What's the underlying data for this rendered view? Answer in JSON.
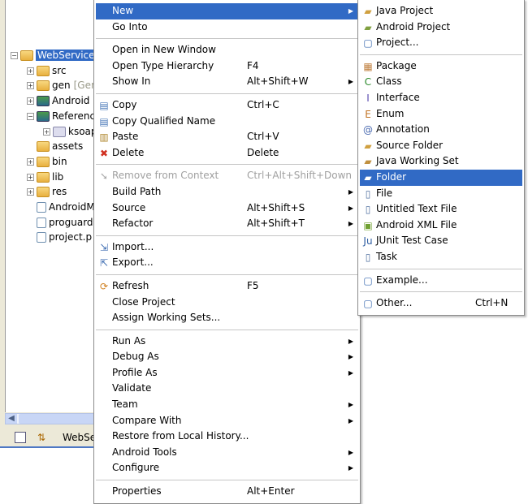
{
  "tree": [
    {
      "label": "WebService",
      "toggle": "−",
      "indent": 0,
      "icon": "project-icon",
      "selected": true
    },
    {
      "label": "src",
      "toggle": "+",
      "indent": 1,
      "icon": "source-folder-icon"
    },
    {
      "label": "gen",
      "decoration": "[Gen",
      "toggle": "+",
      "indent": 1,
      "icon": "source-folder-icon"
    },
    {
      "label": "Android",
      "toggle": "+",
      "indent": 1,
      "icon": "library-icon"
    },
    {
      "label": "Referenc",
      "toggle": "−",
      "indent": 1,
      "icon": "library-icon"
    },
    {
      "label": "ksoap",
      "toggle": "+",
      "indent": 2,
      "icon": "jar-icon"
    },
    {
      "label": "assets",
      "toggle": "",
      "indent": 1,
      "icon": "folder-icon"
    },
    {
      "label": "bin",
      "toggle": "+",
      "indent": 1,
      "icon": "folder-icon"
    },
    {
      "label": "lib",
      "toggle": "+",
      "indent": 1,
      "icon": "folder-icon"
    },
    {
      "label": "res",
      "toggle": "+",
      "indent": 1,
      "icon": "folder-icon"
    },
    {
      "label": "AndroidM",
      "toggle": "",
      "indent": 1,
      "icon": "android-manifest-icon"
    },
    {
      "label": "proguard",
      "toggle": "",
      "indent": 1,
      "icon": "file-icon"
    },
    {
      "label": "project.p",
      "toggle": "",
      "indent": 1,
      "icon": "file-icon"
    }
  ],
  "toolbar": {
    "tab_label": "WebSe"
  },
  "colors": {
    "highlight": "#316ac5",
    "disabled": "#a0a0a0"
  },
  "menu": [
    {
      "label": "New",
      "submenu": true,
      "highlighted": true
    },
    {
      "label": "Go Into"
    },
    {
      "sep": true
    },
    {
      "label": "Open in New Window"
    },
    {
      "label": "Open Type Hierarchy",
      "shortcut": "F4"
    },
    {
      "label": "Show In",
      "shortcut": "Alt+Shift+W",
      "submenu": true
    },
    {
      "sep": true
    },
    {
      "label": "Copy",
      "shortcut": "Ctrl+C",
      "icon": "copy-icon"
    },
    {
      "label": "Copy Qualified Name",
      "icon": "copy-qualified-name-icon"
    },
    {
      "label": "Paste",
      "shortcut": "Ctrl+V",
      "icon": "paste-icon"
    },
    {
      "label": "Delete",
      "shortcut": "Delete",
      "icon": "delete-icon"
    },
    {
      "sep": true
    },
    {
      "label": "Remove from Context",
      "shortcut": "Ctrl+Alt+Shift+Down",
      "icon": "remove-context-icon",
      "disabled": true
    },
    {
      "label": "Build Path",
      "submenu": true
    },
    {
      "label": "Source",
      "shortcut": "Alt+Shift+S",
      "submenu": true
    },
    {
      "label": "Refactor",
      "shortcut": "Alt+Shift+T",
      "submenu": true
    },
    {
      "sep": true
    },
    {
      "label": "Import...",
      "icon": "import-icon"
    },
    {
      "label": "Export...",
      "icon": "export-icon"
    },
    {
      "sep": true
    },
    {
      "label": "Refresh",
      "shortcut": "F5",
      "icon": "refresh-icon"
    },
    {
      "label": "Close Project"
    },
    {
      "label": "Assign Working Sets..."
    },
    {
      "sep": true
    },
    {
      "label": "Run As",
      "submenu": true
    },
    {
      "label": "Debug As",
      "submenu": true
    },
    {
      "label": "Profile As",
      "submenu": true
    },
    {
      "label": "Validate"
    },
    {
      "label": "Team",
      "submenu": true
    },
    {
      "label": "Compare With",
      "submenu": true
    },
    {
      "label": "Restore from Local History..."
    },
    {
      "label": "Android Tools",
      "submenu": true
    },
    {
      "label": "Configure",
      "submenu": true
    },
    {
      "sep": true
    },
    {
      "label": "Properties",
      "shortcut": "Alt+Enter"
    }
  ],
  "submenu": [
    {
      "label": "Java Project",
      "icon": "java-project-icon"
    },
    {
      "label": "Android Project",
      "icon": "android-project-icon"
    },
    {
      "label": "Project...",
      "icon": "project-wizard-icon"
    },
    {
      "sep": true
    },
    {
      "label": "Package",
      "icon": "package-icon"
    },
    {
      "label": "Class",
      "icon": "class-icon"
    },
    {
      "label": "Interface",
      "icon": "interface-icon"
    },
    {
      "label": "Enum",
      "icon": "enum-icon"
    },
    {
      "label": "Annotation",
      "icon": "annotation-icon"
    },
    {
      "label": "Source Folder",
      "icon": "source-folder-icon"
    },
    {
      "label": "Java Working Set",
      "icon": "working-set-icon"
    },
    {
      "label": "Folder",
      "icon": "folder-icon",
      "highlighted": true
    },
    {
      "label": "File",
      "icon": "file-icon"
    },
    {
      "label": "Untitled Text File",
      "icon": "text-file-icon"
    },
    {
      "label": "Android XML File",
      "icon": "android-xml-icon"
    },
    {
      "label": "JUnit Test Case",
      "icon": "junit-icon"
    },
    {
      "label": "Task",
      "icon": "task-icon"
    },
    {
      "sep": true
    },
    {
      "label": "Example...",
      "icon": "example-icon"
    },
    {
      "sep": true
    },
    {
      "label": "Other...",
      "shortcut": "Ctrl+N",
      "icon": "other-icon"
    }
  ]
}
